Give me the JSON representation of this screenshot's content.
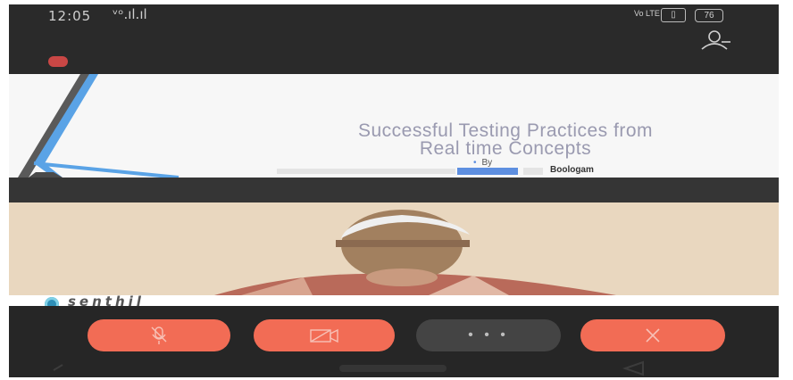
{
  "status_bar": {
    "time": "12:05",
    "signal": "ᵛᵒ.ıl.ıl",
    "network": "Vo LTE",
    "battery": "76"
  },
  "slide": {
    "title_line1": "Successful Testing Practices from",
    "title_line2": "Real time Concepts",
    "by": "By",
    "author": "Boologam"
  },
  "participant": {
    "name": "senthil"
  },
  "controls": {
    "more_label": "• • •"
  },
  "colors": {
    "accent": "#f26c55",
    "slide_blue": "#5e8fe0",
    "avatar_blue": "#2e8fb8"
  }
}
